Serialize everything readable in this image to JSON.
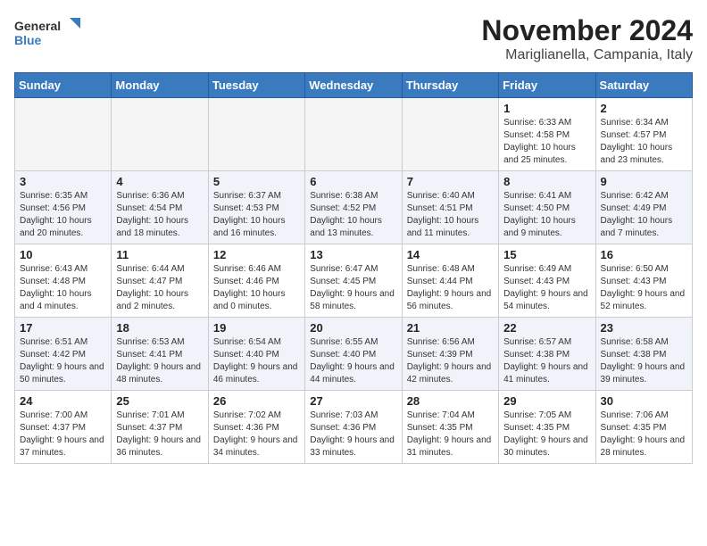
{
  "logo": {
    "line1": "General",
    "line2": "Blue"
  },
  "title": "November 2024",
  "subtitle": "Mariglianella, Campania, Italy",
  "weekdays": [
    "Sunday",
    "Monday",
    "Tuesday",
    "Wednesday",
    "Thursday",
    "Friday",
    "Saturday"
  ],
  "weeks": [
    [
      {
        "day": "",
        "info": ""
      },
      {
        "day": "",
        "info": ""
      },
      {
        "day": "",
        "info": ""
      },
      {
        "day": "",
        "info": ""
      },
      {
        "day": "",
        "info": ""
      },
      {
        "day": "1",
        "info": "Sunrise: 6:33 AM\nSunset: 4:58 PM\nDaylight: 10 hours and 25 minutes."
      },
      {
        "day": "2",
        "info": "Sunrise: 6:34 AM\nSunset: 4:57 PM\nDaylight: 10 hours and 23 minutes."
      }
    ],
    [
      {
        "day": "3",
        "info": "Sunrise: 6:35 AM\nSunset: 4:56 PM\nDaylight: 10 hours and 20 minutes."
      },
      {
        "day": "4",
        "info": "Sunrise: 6:36 AM\nSunset: 4:54 PM\nDaylight: 10 hours and 18 minutes."
      },
      {
        "day": "5",
        "info": "Sunrise: 6:37 AM\nSunset: 4:53 PM\nDaylight: 10 hours and 16 minutes."
      },
      {
        "day": "6",
        "info": "Sunrise: 6:38 AM\nSunset: 4:52 PM\nDaylight: 10 hours and 13 minutes."
      },
      {
        "day": "7",
        "info": "Sunrise: 6:40 AM\nSunset: 4:51 PM\nDaylight: 10 hours and 11 minutes."
      },
      {
        "day": "8",
        "info": "Sunrise: 6:41 AM\nSunset: 4:50 PM\nDaylight: 10 hours and 9 minutes."
      },
      {
        "day": "9",
        "info": "Sunrise: 6:42 AM\nSunset: 4:49 PM\nDaylight: 10 hours and 7 minutes."
      }
    ],
    [
      {
        "day": "10",
        "info": "Sunrise: 6:43 AM\nSunset: 4:48 PM\nDaylight: 10 hours and 4 minutes."
      },
      {
        "day": "11",
        "info": "Sunrise: 6:44 AM\nSunset: 4:47 PM\nDaylight: 10 hours and 2 minutes."
      },
      {
        "day": "12",
        "info": "Sunrise: 6:46 AM\nSunset: 4:46 PM\nDaylight: 10 hours and 0 minutes."
      },
      {
        "day": "13",
        "info": "Sunrise: 6:47 AM\nSunset: 4:45 PM\nDaylight: 9 hours and 58 minutes."
      },
      {
        "day": "14",
        "info": "Sunrise: 6:48 AM\nSunset: 4:44 PM\nDaylight: 9 hours and 56 minutes."
      },
      {
        "day": "15",
        "info": "Sunrise: 6:49 AM\nSunset: 4:43 PM\nDaylight: 9 hours and 54 minutes."
      },
      {
        "day": "16",
        "info": "Sunrise: 6:50 AM\nSunset: 4:43 PM\nDaylight: 9 hours and 52 minutes."
      }
    ],
    [
      {
        "day": "17",
        "info": "Sunrise: 6:51 AM\nSunset: 4:42 PM\nDaylight: 9 hours and 50 minutes."
      },
      {
        "day": "18",
        "info": "Sunrise: 6:53 AM\nSunset: 4:41 PM\nDaylight: 9 hours and 48 minutes."
      },
      {
        "day": "19",
        "info": "Sunrise: 6:54 AM\nSunset: 4:40 PM\nDaylight: 9 hours and 46 minutes."
      },
      {
        "day": "20",
        "info": "Sunrise: 6:55 AM\nSunset: 4:40 PM\nDaylight: 9 hours and 44 minutes."
      },
      {
        "day": "21",
        "info": "Sunrise: 6:56 AM\nSunset: 4:39 PM\nDaylight: 9 hours and 42 minutes."
      },
      {
        "day": "22",
        "info": "Sunrise: 6:57 AM\nSunset: 4:38 PM\nDaylight: 9 hours and 41 minutes."
      },
      {
        "day": "23",
        "info": "Sunrise: 6:58 AM\nSunset: 4:38 PM\nDaylight: 9 hours and 39 minutes."
      }
    ],
    [
      {
        "day": "24",
        "info": "Sunrise: 7:00 AM\nSunset: 4:37 PM\nDaylight: 9 hours and 37 minutes."
      },
      {
        "day": "25",
        "info": "Sunrise: 7:01 AM\nSunset: 4:37 PM\nDaylight: 9 hours and 36 minutes."
      },
      {
        "day": "26",
        "info": "Sunrise: 7:02 AM\nSunset: 4:36 PM\nDaylight: 9 hours and 34 minutes."
      },
      {
        "day": "27",
        "info": "Sunrise: 7:03 AM\nSunset: 4:36 PM\nDaylight: 9 hours and 33 minutes."
      },
      {
        "day": "28",
        "info": "Sunrise: 7:04 AM\nSunset: 4:35 PM\nDaylight: 9 hours and 31 minutes."
      },
      {
        "day": "29",
        "info": "Sunrise: 7:05 AM\nSunset: 4:35 PM\nDaylight: 9 hours and 30 minutes."
      },
      {
        "day": "30",
        "info": "Sunrise: 7:06 AM\nSunset: 4:35 PM\nDaylight: 9 hours and 28 minutes."
      }
    ]
  ]
}
